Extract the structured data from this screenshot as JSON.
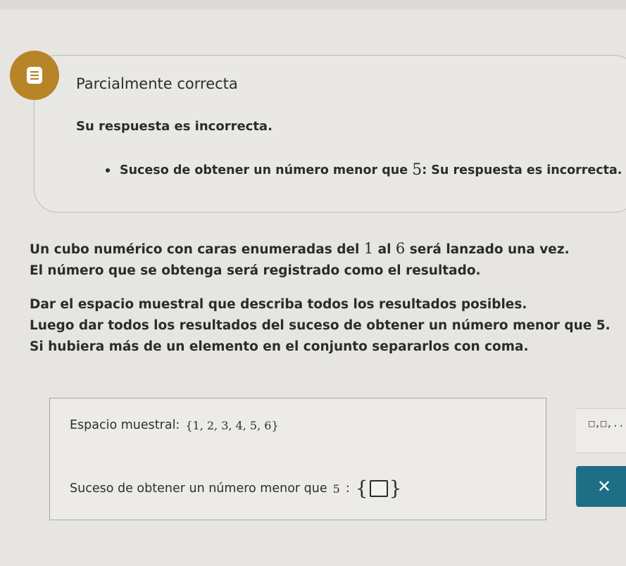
{
  "colors": {
    "background": "#e7e5e2",
    "feedback_icon": "#b88428",
    "clear_button": "#1e6f86"
  },
  "feedback": {
    "icon": "feedback-list-icon",
    "title": "Parcialmente correcta",
    "message": "Su respuesta es incorrecta.",
    "bullet_prefix": "Suceso de obtener un número menor que",
    "bullet_number": "5",
    "bullet_suffix": ": Su respuesta es incorrecta."
  },
  "problem": {
    "p1_l1_a": "Un cubo numérico con caras enumeradas del",
    "p1_l1_n1": "1",
    "p1_l1_b": "al",
    "p1_l1_n2": "6",
    "p1_l1_c": "será lanzado una vez.",
    "p1_l2": "El número que se obtenga será registrado como el resultado.",
    "p2_l1": "Dar el espacio muestral que describa todos los resultados posibles.",
    "p2_l2": "Luego dar todos los resultados del suceso de obtener un número menor que 5.",
    "p2_l3": "Si hubiera más de un elemento en el conjunto separarlos con coma."
  },
  "answer": {
    "sample_space_label": "Espacio muestral:",
    "sample_space_value": "{1, 2, 3, 4, 5, 6}",
    "event_label": "Suceso de obtener un número menor que",
    "event_number": "5",
    "event_colon": ":",
    "brace_open": "{",
    "brace_close": "}",
    "event_input_value": ""
  },
  "tools": {
    "set_tool_icon": "set-template-icon",
    "set_tool_glyph": "□,□,...",
    "clear_icon": "close-icon",
    "clear_glyph": "✕"
  }
}
